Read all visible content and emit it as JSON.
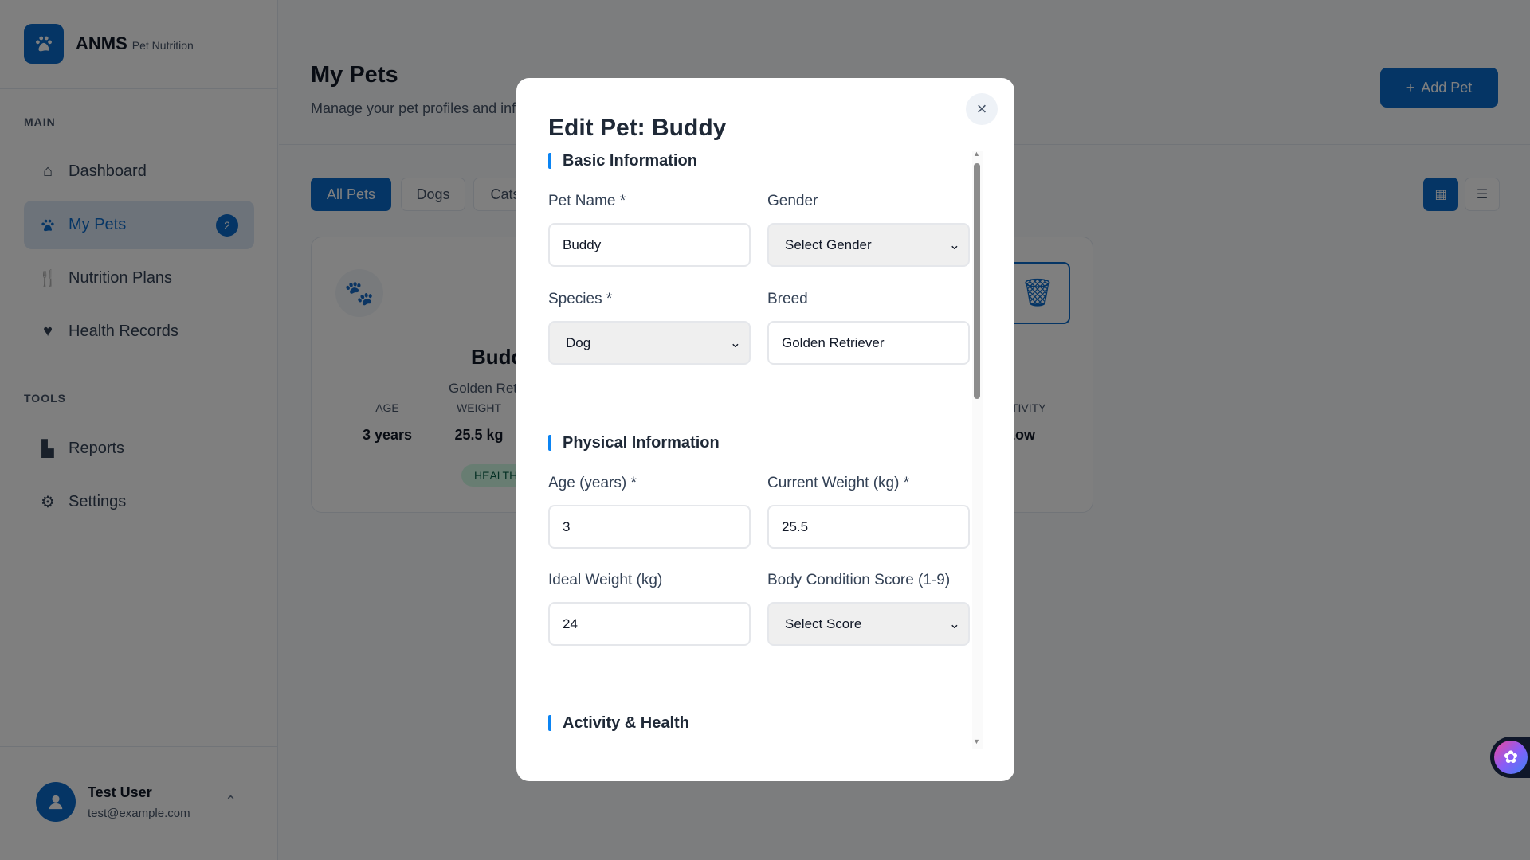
{
  "sidebar": {
    "brand": "ANMS",
    "brand_sub": "Pet Nutrition",
    "sections": [
      "MAIN",
      "TOOLS"
    ],
    "items": [
      {
        "label": "Dashboard",
        "icon": "home-icon"
      },
      {
        "label": "My Pets",
        "icon": "paw-icon",
        "badge": "2",
        "active": true
      },
      {
        "label": "Nutrition Plans",
        "icon": "utensils-icon"
      },
      {
        "label": "Health Records",
        "icon": "heart-icon"
      },
      {
        "label": "Reports",
        "icon": "chart-icon"
      },
      {
        "label": "Settings",
        "icon": "gear-icon"
      }
    ],
    "user": {
      "name": "Test User",
      "email": "test@example.com"
    }
  },
  "header": {
    "title": "My Pets",
    "subtitle": "Manage your pet profiles and information",
    "add_label": "Add Pet"
  },
  "filters": [
    "All Pets",
    "Dogs",
    "Cats"
  ],
  "card": {
    "name": "Buddy",
    "breed": "Golden Retriever",
    "age_label": "AGE",
    "age": "3 years",
    "weight_label": "WEIGHT",
    "weight": "25.5 kg",
    "activity_label": "ACTIVITY",
    "activity": "Low",
    "status": "HEALTHY"
  },
  "modal": {
    "title": "Edit Pet: Buddy",
    "sections": {
      "basic": "Basic Information",
      "physical": "Physical Information",
      "activity": "Activity & Health"
    },
    "fields": {
      "name": {
        "label": "Pet Name *",
        "value": "Buddy"
      },
      "gender": {
        "label": "Gender",
        "value": "Select Gender"
      },
      "species": {
        "label": "Species *",
        "value": "Dog"
      },
      "breed": {
        "label": "Breed",
        "value": "Golden Retriever"
      },
      "age": {
        "label": "Age (years) *",
        "value": "3"
      },
      "weight": {
        "label": "Current Weight (kg) *",
        "value": "25.5"
      },
      "ideal": {
        "label": "Ideal Weight (kg)",
        "value": "24"
      },
      "bcs": {
        "label": "Body Condition Score (1-9)",
        "value": "Select Score"
      }
    }
  },
  "colors": {
    "accent": "#0b6bcb",
    "section_bar": "#0b84f3"
  }
}
